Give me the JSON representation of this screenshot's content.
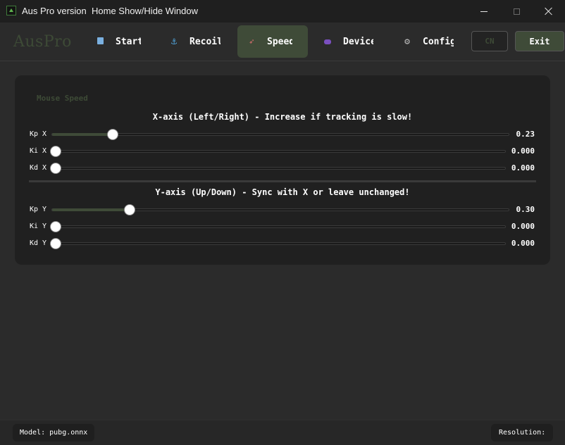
{
  "window": {
    "title": "Aus Pro version",
    "action": "Home Show/Hide Window"
  },
  "nav": {
    "brand": "AusPro",
    "tabs": [
      {
        "label": "Start",
        "icon": "monitor-icon"
      },
      {
        "label": "Recoil",
        "icon": "anchor-icon"
      },
      {
        "label": "Speed",
        "icon": "rocket-icon",
        "active": true
      },
      {
        "label": "Device",
        "icon": "gamepad-icon"
      },
      {
        "label": "Config",
        "icon": "gear-icon"
      }
    ],
    "cn_label": "CN",
    "exit_label": "Exit"
  },
  "panel": {
    "title": "Mouse Speed",
    "x_heading": "X-axis (Left/Right) - Increase if tracking is slow!",
    "y_heading": "Y-axis (Up/Down) - Sync with X or leave unchanged!",
    "x_sliders": [
      {
        "label": "Kp X",
        "value": "0.23",
        "fraction": 0.124
      },
      {
        "label": "Ki X",
        "value": "0.000",
        "fraction": 0.0
      },
      {
        "label": "Kd X",
        "value": "0.000",
        "fraction": 0.0
      }
    ],
    "y_sliders": [
      {
        "label": "Kp Y",
        "value": "0.30",
        "fraction": 0.161
      },
      {
        "label": "Ki Y",
        "value": "0.000",
        "fraction": 0.0
      },
      {
        "label": "Kd Y",
        "value": "0.000",
        "fraction": 0.0
      }
    ]
  },
  "status": {
    "model": "Model: pubg.onnx",
    "resolution": "Resolution:"
  },
  "colors": {
    "accent": "#3f4b38",
    "background": "#2b2b2b",
    "panel": "#202020"
  }
}
